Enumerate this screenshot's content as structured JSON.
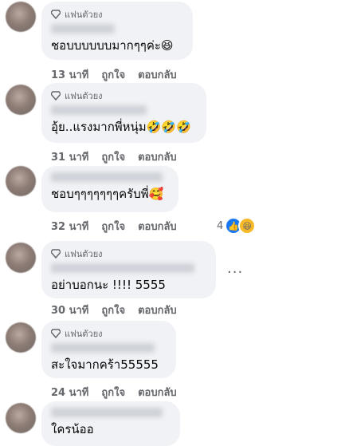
{
  "badge_label": "แฟนตัวยง",
  "comments": [
    {
      "time": "13 นาที",
      "like": "ถูกใจ",
      "reply": "ตอบกลับ",
      "text": "ชอบบบบบบมากๆๆค่ะ😆",
      "has_badge": true
    },
    {
      "time": "31 นาที",
      "like": "ถูกใจ",
      "reply": "ตอบกลับ",
      "text": "อุ้ย..แรงมากพี่หนุ่ม🤣🤣🤣",
      "has_badge": true
    },
    {
      "time": "32 นาที",
      "like": "ถูกใจ",
      "reply": "ตอบกลับ",
      "text": "ชอบๆๆๆๆๆๆๆครับพี่🥰",
      "has_badge": false,
      "reaction_count": "4"
    },
    {
      "time": "30 นาที",
      "like": "ถูกใจ",
      "reply": "ตอบกลับ",
      "text": "อย่าบอกนะ !!!! 5555",
      "has_badge": true
    },
    {
      "time": "24 นาที",
      "like": "ถูกใจ",
      "reply": "ตอบกลับ",
      "text": "สะใจมากคร้า55555",
      "has_badge": true
    },
    {
      "text": "ใครน้ออ",
      "has_badge": false
    }
  ],
  "more_label": "...",
  "icons": {
    "badge": "diamond-icon",
    "like": "like-reaction-icon",
    "haha": "haha-reaction-icon"
  },
  "colors": {
    "bubble": "#f0f2f5",
    "meta": "#65676b",
    "like": "#1877f2"
  }
}
